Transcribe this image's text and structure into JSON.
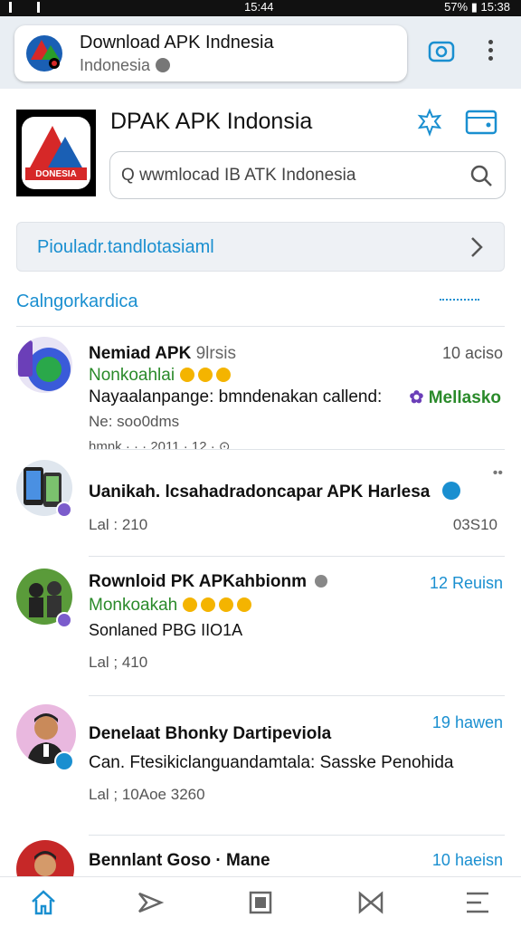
{
  "status_bar": {
    "time": "15:44",
    "right": "57% ▮ 15:38"
  },
  "browser": {
    "tab_title": "Download APK Indnesia",
    "tab_subtitle": "Indonesia"
  },
  "site": {
    "title": "DPAK APK Indonsia",
    "logo_text": "DONESIA",
    "search_placeholder": "wwmlocad IB ATK Indonesia"
  },
  "banner": {
    "text": "Piouladr.tandlotasiaml"
  },
  "category": {
    "label": "Calngorkardica"
  },
  "feed": [
    {
      "title": "Nemiad APK",
      "title_extra": "9lrsis",
      "time": "10 aciso",
      "green": "Nonkoahlai",
      "text": "Nayaalanpange: bmndenakan callend:",
      "green_right": "Mellasko",
      "meta1": "Ne: soo0dms",
      "meta2": "hmnk · · · 2011 · 12 · ⊙"
    },
    {
      "title": "Uanikah. lcsahadradoncapar APK Harlesa",
      "meta1": "Lal : 210",
      "meta_right": "03S10"
    },
    {
      "title": "Rownloid PK APKahbionm",
      "time": "12 Reuisn",
      "green": "Monkoakah",
      "text": "Sonlaned PBG IIO1A",
      "meta1": "Lal ; 410"
    },
    {
      "title": "Denelaat Bhonky Dartipeviola",
      "time": "19 hawen",
      "text": "Can. Ftesikiclanguandamtala: Sasske Penohida",
      "meta1": "Lal ; 10Aoe 3260"
    },
    {
      "title": "Bennlant Goso · Mane",
      "time": "10 haeisn"
    }
  ],
  "tabs": [
    "home",
    "share",
    "bookmark",
    "bow",
    "menu"
  ],
  "colors": {
    "accent": "#1a8fd0",
    "green": "#2a8a2a",
    "logo_red": "#d62828"
  }
}
